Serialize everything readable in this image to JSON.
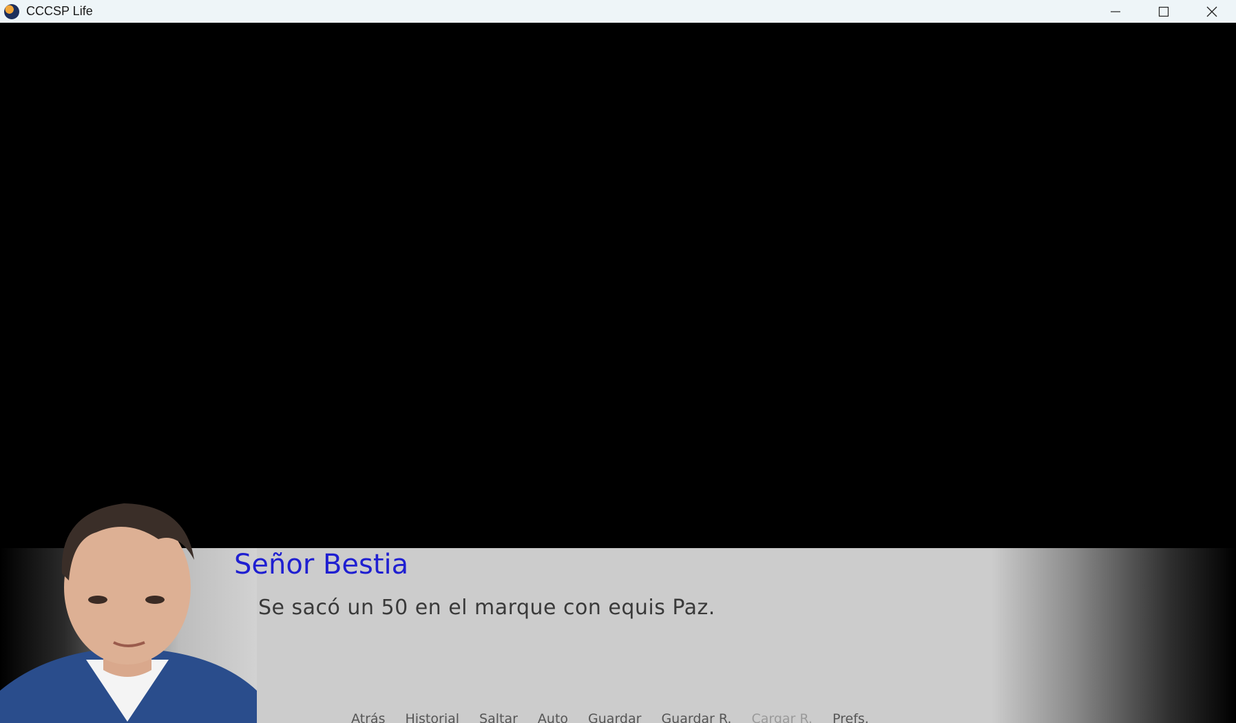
{
  "window": {
    "title": "CCCSP Life",
    "controls": [
      "minimize-icon",
      "maximize-icon",
      "close-icon"
    ]
  },
  "dialogue": {
    "speaker": "Señor Bestia",
    "text": "Se sacó un 50 en el marque con equis Paz.",
    "speaker_color": "#1f1fd1"
  },
  "quick_menu": {
    "back": "Atrás",
    "history": "Historial",
    "skip": "Saltar",
    "auto": "Auto",
    "save": "Guardar",
    "quick_save": "Guardar R.",
    "quick_load": "Cargar R.",
    "prefs": "Prefs."
  }
}
